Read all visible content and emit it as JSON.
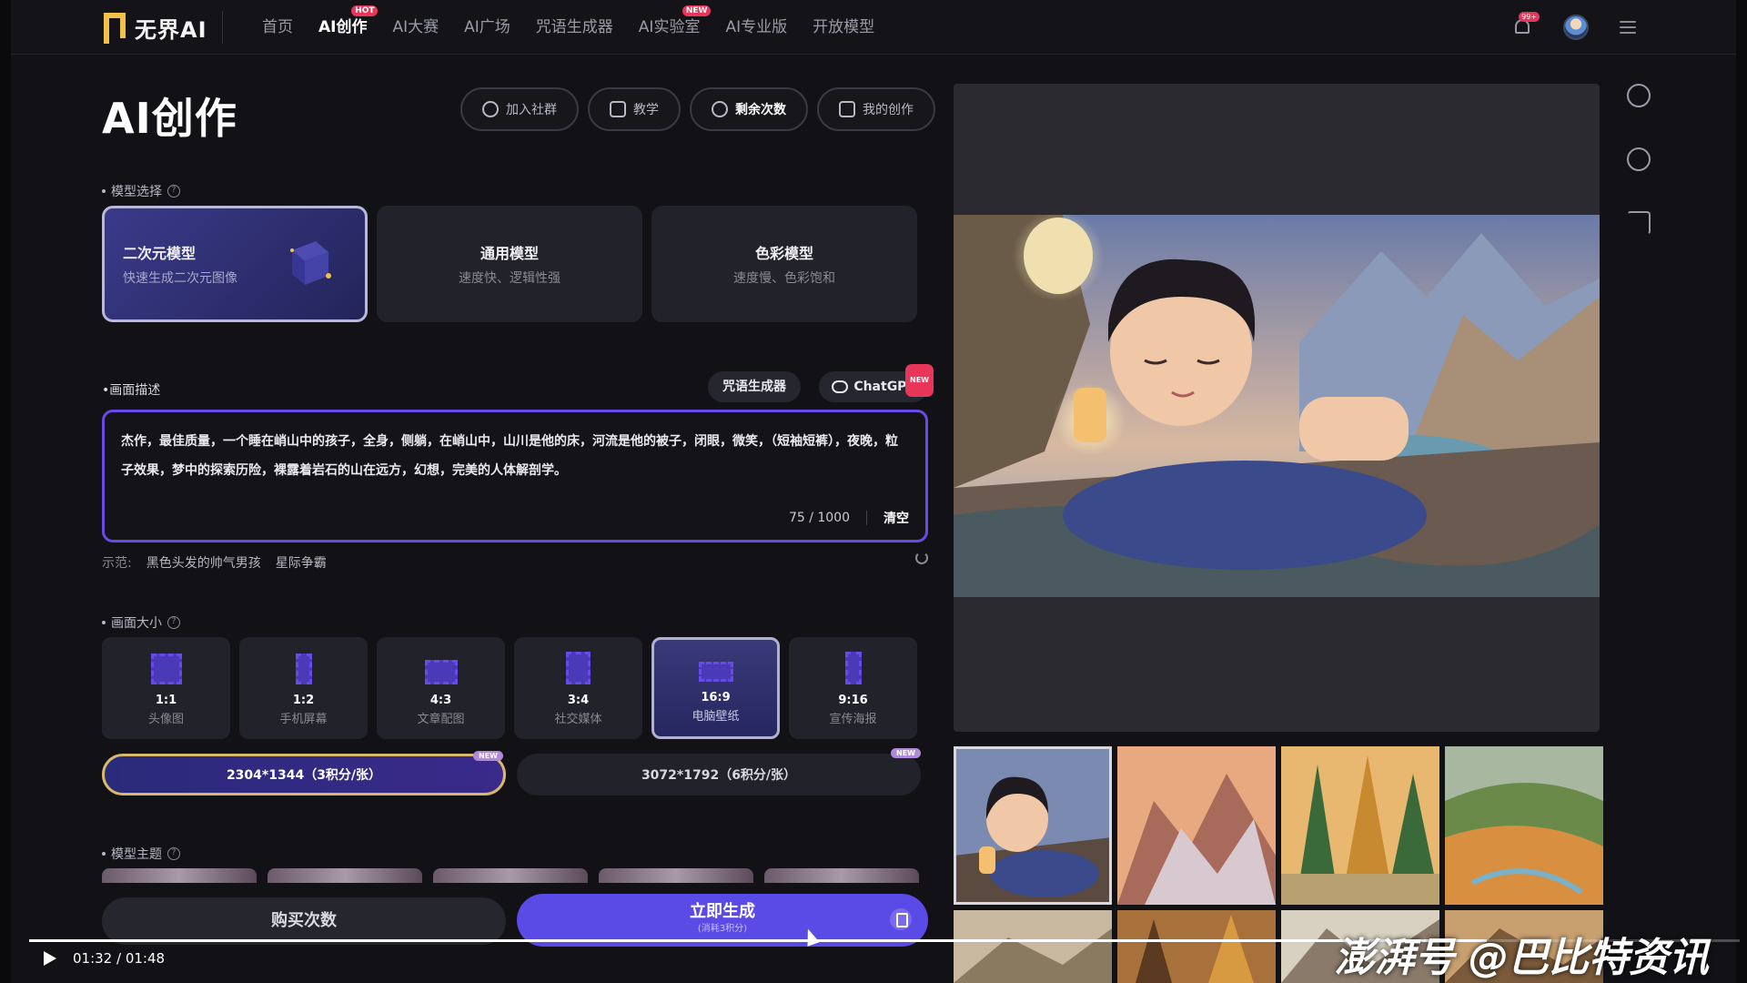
{
  "nav": {
    "logo_text": "无界AI",
    "items": [
      {
        "label": "首页",
        "active": false,
        "badge": ""
      },
      {
        "label": "AI创作",
        "active": true,
        "badge": "HOT"
      },
      {
        "label": "AI大赛",
        "active": false,
        "badge": ""
      },
      {
        "label": "AI广场",
        "active": false,
        "badge": ""
      },
      {
        "label": "咒语生成器",
        "active": false,
        "badge": ""
      },
      {
        "label": "AI实验室",
        "active": false,
        "badge": "NEW"
      },
      {
        "label": "AI专业版",
        "active": false,
        "badge": ""
      },
      {
        "label": "开放模型",
        "active": false,
        "badge": ""
      }
    ],
    "bell_badge": "99+"
  },
  "header": {
    "title": "AI创作",
    "pills": [
      "加入社群",
      "教学",
      "剩余次数",
      "我的创作"
    ]
  },
  "model_section": {
    "label": "模型选择",
    "cards": [
      {
        "title": "二次元模型",
        "subtitle": "快速生成二次元图像"
      },
      {
        "title": "通用模型",
        "subtitle": "速度快、逻辑性强"
      },
      {
        "title": "色彩模型",
        "subtitle": "速度慢、色彩饱和"
      }
    ]
  },
  "prompt": {
    "label": "画面描述",
    "generator_button": "咒语生成器",
    "chatgpt_button": "ChatGPT",
    "chatgpt_badge": "NEW",
    "text": "杰作，最佳质量，一个睡在峭山中的孩子，全身，侧躺，在峭山中，山川是他的床，河流是他的被子，闭眼，微笑，（短袖短裤），夜晚，粒子效果，梦中的探索历险，裸露着岩石的山在远方，幻想，完美的人体解剖学。",
    "counter": "75 / 1000",
    "clear_label": "清空"
  },
  "examples": {
    "label": "示范:",
    "items": [
      "黑色头发的帅气男孩",
      "星际争霸"
    ]
  },
  "size_section": {
    "label": "画面大小",
    "options": [
      {
        "ratio": "1:1",
        "use": "头像图"
      },
      {
        "ratio": "1:2",
        "use": "手机屏幕"
      },
      {
        "ratio": "4:3",
        "use": "文章配图"
      },
      {
        "ratio": "3:4",
        "use": "社交媒体"
      },
      {
        "ratio": "16:9",
        "use": "电脑壁纸"
      },
      {
        "ratio": "9:16",
        "use": "宣传海报"
      }
    ],
    "resolutions": [
      {
        "label": "2304*1344（3积分/张）",
        "badge": "NEW"
      },
      {
        "label": "3072*1792（6积分/张）",
        "badge": "NEW"
      }
    ]
  },
  "theme_section": {
    "label": "模型主题"
  },
  "actions": {
    "buy_label": "购买次数",
    "generate_label": "立即生成",
    "generate_sub": "(消耗3积分)"
  },
  "video": {
    "time": "01:32 / 01:48",
    "progress": 0.852,
    "watermark": "澎湃号 @巴比特资讯"
  },
  "colors": {
    "accent": "#5a4ae6",
    "selected_border": "#6a4ae6",
    "background": "#121216"
  }
}
